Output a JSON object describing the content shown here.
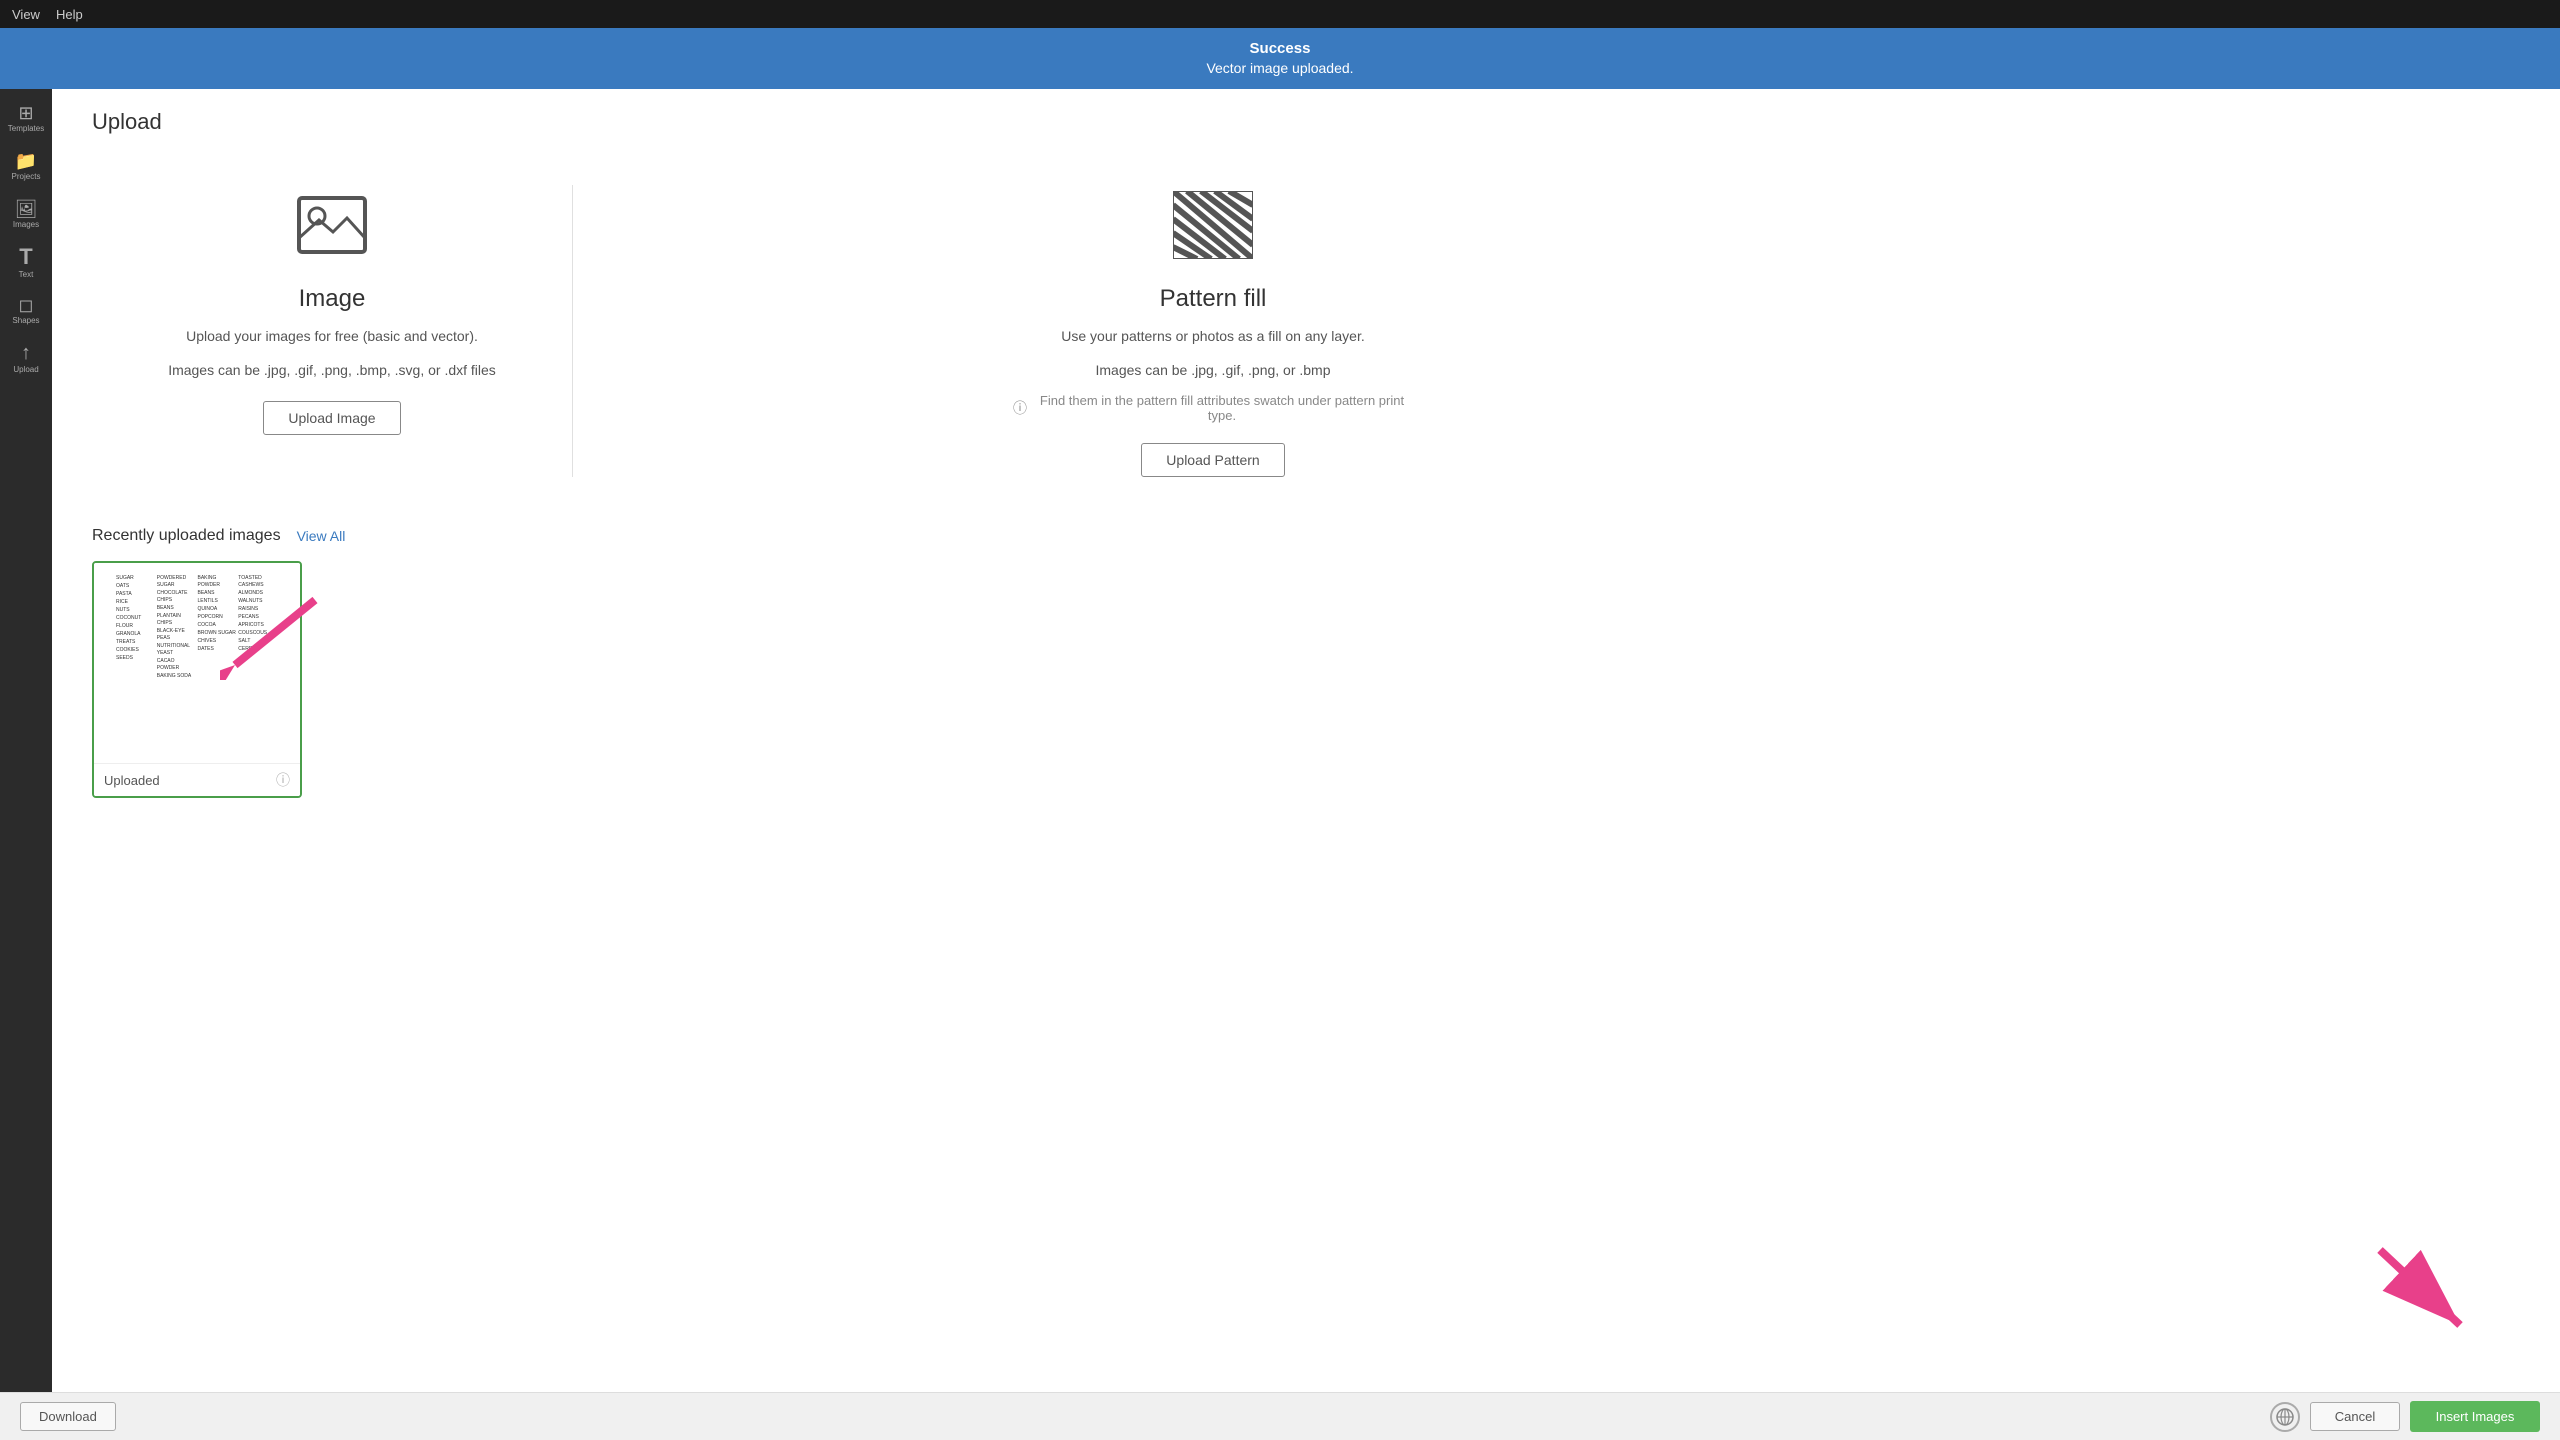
{
  "menubar": {
    "items": [
      "View",
      "Help"
    ]
  },
  "success_banner": {
    "title": "Success",
    "message": "Vector image uploaded."
  },
  "page": {
    "title": "Upload"
  },
  "image_card": {
    "title": "Image",
    "desc1": "Upload your images for free (basic and vector).",
    "desc2": "Images can be .jpg, .gif, .png, .bmp, .svg, or .dxf files",
    "button": "Upload Image"
  },
  "pattern_card": {
    "title": "Pattern fill",
    "desc1": "Use your patterns or photos as a fill on any layer.",
    "desc2": "Images can be .jpg, .gif, .png, or .bmp",
    "note": "Find them in the pattern fill attributes swatch under pattern print type.",
    "button": "Upload Pattern"
  },
  "recently": {
    "title": "Recently uploaded images",
    "view_all": "View All",
    "image_label": "Uploaded"
  },
  "toolbar": {
    "download": "Download",
    "cancel": "Cancel",
    "insert": "Insert Images"
  },
  "sidebar": {
    "items": [
      {
        "label": "Templates",
        "icon": "⊞"
      },
      {
        "label": "Projects",
        "icon": "📁"
      },
      {
        "label": "Images",
        "icon": "🖼"
      },
      {
        "label": "Text",
        "icon": "T"
      },
      {
        "label": "Shapes",
        "icon": "◻"
      },
      {
        "label": "Upload",
        "icon": "↑"
      }
    ]
  },
  "grocery_items": [
    [
      "SUGAR",
      "OATS",
      "PASTA",
      "RICE",
      "NUTS",
      "COCONUT",
      "FLOUR",
      "GRANOLA",
      "TREATS",
      "COOKIES",
      "SEEDS"
    ],
    [
      "POWDERED SUGAR",
      "CHOCOLATE CHIPS",
      "PLANTAIN CHIPS",
      "BLACK-EYE PEAS",
      "NUTRITIONAL YEAST",
      "CACAO POWDER",
      "BAKING SODA"
    ],
    [
      "BAKING POWDER",
      "BEANS",
      "LENTILS",
      "QUINOA",
      "POPCORN",
      "COCOA",
      "BROWN SUGAR",
      "CHIVES",
      "DATES"
    ],
    [
      "TOASTED CASHEWS",
      "ALMONDS",
      "WALNUTS",
      "RAISINS",
      "PECANS",
      "APRICOTS",
      "COUSCOUS",
      "SALT",
      "CEREAL"
    ]
  ]
}
